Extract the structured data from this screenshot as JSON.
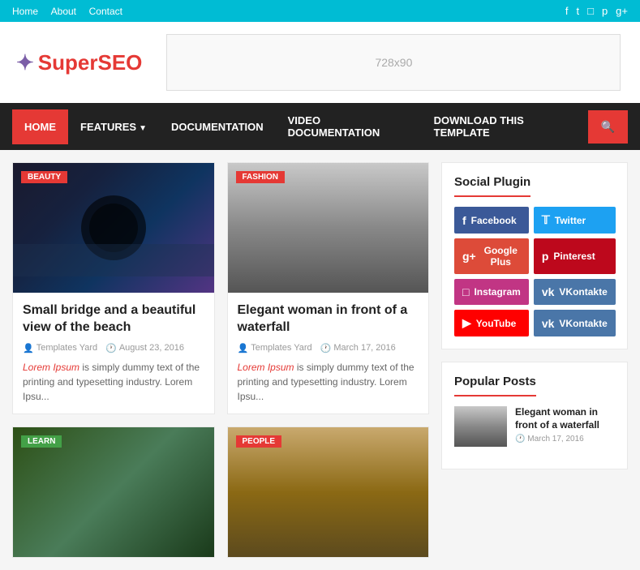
{
  "topbar": {
    "nav": [
      "Home",
      "About",
      "Contact"
    ],
    "icons": [
      "f",
      "t",
      "ig",
      "p",
      "g+"
    ]
  },
  "header": {
    "logo_static": "Super",
    "logo_seo": "SEO",
    "ad_text": "728x90"
  },
  "nav": {
    "items": [
      {
        "label": "HOME",
        "active": true
      },
      {
        "label": "FEATURES",
        "dropdown": true
      },
      {
        "label": "DOCUMENTATION"
      },
      {
        "label": "VIDEO DOCUMENTATION"
      },
      {
        "label": "DOWNLOAD THIS TEMPLATE"
      }
    ]
  },
  "posts": [
    {
      "tag": "BEAUTY",
      "tag_class": "tag-beauty",
      "img_class": "img-bridge",
      "title": "Small bridge and a beautiful view of the beach",
      "author": "Templates Yard",
      "date": "August 23, 2016",
      "excerpt": "Lorem Ipsum is simply dummy text of the printing and typesetting industry. Lorem Ipsu..."
    },
    {
      "tag": "FASHION",
      "tag_class": "tag-fashion",
      "img_class": "img-woman",
      "title": "Elegant woman in front of a waterfall",
      "author": "Templates Yard",
      "date": "March 17, 2016",
      "excerpt": "Lorem Ipsum is simply dummy text of the printing and typesetting industry. Lorem Ipsu..."
    },
    {
      "tag": "LEARN",
      "tag_class": "tag-learn",
      "img_class": "img-bottom-left",
      "title": "",
      "author": "",
      "date": "",
      "excerpt": ""
    },
    {
      "tag": "PEOPLE",
      "tag_class": "tag-people",
      "img_class": "img-bottom-right",
      "title": "",
      "author": "",
      "date": "",
      "excerpt": ""
    }
  ],
  "sidebar": {
    "social_plugin_title": "Social Plugin",
    "social_buttons": [
      {
        "label": "Facebook",
        "class": "facebook",
        "icon": "f"
      },
      {
        "label": "Twitter",
        "class": "twitter",
        "icon": "t"
      },
      {
        "label": "Google Plus",
        "class": "google-plus",
        "icon": "g+"
      },
      {
        "label": "Pinterest",
        "class": "pinterest",
        "icon": "p"
      },
      {
        "label": "Instagram",
        "class": "instagram",
        "icon": "ig"
      },
      {
        "label": "VKontakte",
        "class": "vkontakte",
        "icon": "vk"
      },
      {
        "label": "YouTube",
        "class": "youtube",
        "icon": "yt"
      },
      {
        "label": "VKontakte",
        "class": "vkontakte",
        "icon": "vk"
      }
    ],
    "popular_posts_title": "Popular Posts",
    "popular_posts": [
      {
        "title": "Elegant woman in front of a waterfall",
        "date": "March 17, 2016"
      }
    ]
  }
}
